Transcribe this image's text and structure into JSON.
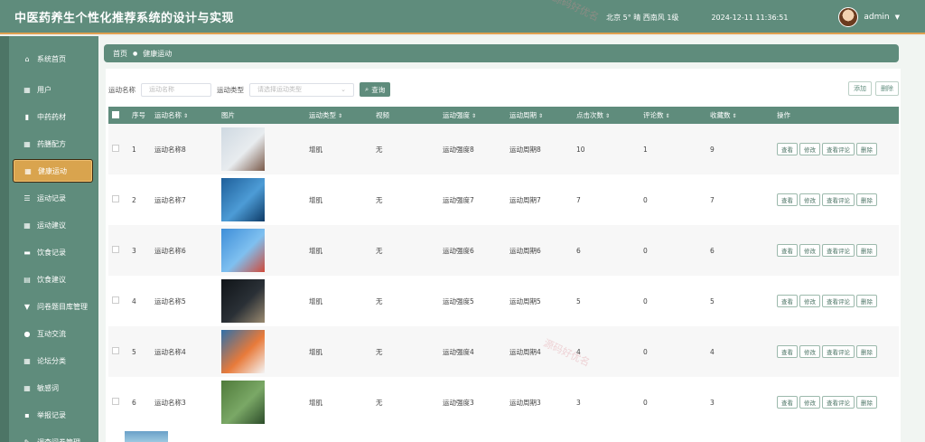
{
  "app": {
    "title": "中医药养生个性化推荐系统的设计与实现"
  },
  "header": {
    "weather": "北京 5° 晴 西南风 1级",
    "datetime": "2024-12-11 11:36:51",
    "user": "admin"
  },
  "sidebar": {
    "items": [
      {
        "label": "系统首页",
        "icon": "home-icon",
        "glyph": "⌂"
      },
      {
        "label": "用户",
        "icon": "grid-icon",
        "glyph": "▦"
      },
      {
        "label": "中药药材",
        "icon": "bar-chart-icon",
        "glyph": "▮"
      },
      {
        "label": "药膳配方",
        "icon": "grid-icon",
        "glyph": "▦"
      },
      {
        "label": "健康运动",
        "icon": "grid-icon",
        "glyph": "▦"
      },
      {
        "label": "运动记录",
        "icon": "sliders-icon",
        "glyph": "☰"
      },
      {
        "label": "运动建议",
        "icon": "grid-icon",
        "glyph": "▦"
      },
      {
        "label": "饮食记录",
        "icon": "briefcase-icon",
        "glyph": "▬"
      },
      {
        "label": "饮食建议",
        "icon": "clipboard-icon",
        "glyph": "▤"
      },
      {
        "label": "问卷题目库管理",
        "icon": "trophy-icon",
        "glyph": "▼"
      },
      {
        "label": "互动交流",
        "icon": "pin-icon",
        "glyph": "●"
      },
      {
        "label": "论坛分类",
        "icon": "grid-icon",
        "glyph": "▦"
      },
      {
        "label": "敏感词",
        "icon": "grid-icon",
        "glyph": "▦"
      },
      {
        "label": "举报记录",
        "icon": "chat-icon",
        "glyph": "▪"
      },
      {
        "label": "调查问卷管理",
        "icon": "edit-icon",
        "glyph": "✎"
      }
    ],
    "active_index": 4
  },
  "breadcrumb": {
    "home": "首页",
    "sep": "●",
    "current": "健康运动"
  },
  "search": {
    "name_label": "运动名称",
    "name_placeholder": "运动名称",
    "type_label": "运动类型",
    "type_placeholder": "请选择运动类型",
    "button": "查询",
    "add": "添加",
    "delete": "删除"
  },
  "table": {
    "columns": [
      "序号",
      "运动名称",
      "图片",
      "运动类型",
      "视频",
      "运动强度",
      "运动周期",
      "点击次数",
      "评论数",
      "收藏数",
      "操作"
    ],
    "sortable": [
      false,
      true,
      false,
      true,
      false,
      true,
      true,
      true,
      true,
      true,
      false
    ],
    "actions": [
      "查看",
      "修改",
      "查看评论",
      "删除"
    ],
    "rows": [
      {
        "no": "1",
        "name": "运动名称8",
        "type": "增肌",
        "video": "无",
        "intensity": "运动强度8",
        "period": "运动周期8",
        "clicks": "10",
        "comments": "1",
        "favorites": "9",
        "pic": [
          "#cfd9e2",
          "#e8ecef",
          "#7a5a4a"
        ]
      },
      {
        "no": "2",
        "name": "运动名称7",
        "type": "增肌",
        "video": "无",
        "intensity": "运动强度7",
        "period": "运动周期7",
        "clicks": "7",
        "comments": "0",
        "favorites": "7",
        "pic": [
          "#1e5f9a",
          "#4d9cd6",
          "#0d3a66"
        ]
      },
      {
        "no": "3",
        "name": "运动名称6",
        "type": "增肌",
        "video": "无",
        "intensity": "运动强度6",
        "period": "运动周期6",
        "clicks": "6",
        "comments": "0",
        "favorites": "6",
        "pic": [
          "#3e8ed8",
          "#7fc0f0",
          "#d04a3a"
        ]
      },
      {
        "no": "4",
        "name": "运动名称5",
        "type": "增肌",
        "video": "无",
        "intensity": "运动强度5",
        "period": "运动周期5",
        "clicks": "5",
        "comments": "0",
        "favorites": "5",
        "pic": [
          "#101418",
          "#2a3036",
          "#9a8a70"
        ]
      },
      {
        "no": "5",
        "name": "运动名称4",
        "type": "增肌",
        "video": "无",
        "intensity": "运动强度4",
        "period": "运动周期4",
        "clicks": "4",
        "comments": "0",
        "favorites": "4",
        "pic": [
          "#2f6fa8",
          "#e87a3a",
          "#f4f4f4"
        ]
      },
      {
        "no": "6",
        "name": "运动名称3",
        "type": "增肌",
        "video": "无",
        "intensity": "运动强度3",
        "period": "运动周期3",
        "clicks": "3",
        "comments": "0",
        "favorites": "3",
        "pic": [
          "#4f7a3a",
          "#7aa866",
          "#2d4d2a"
        ]
      }
    ]
  }
}
